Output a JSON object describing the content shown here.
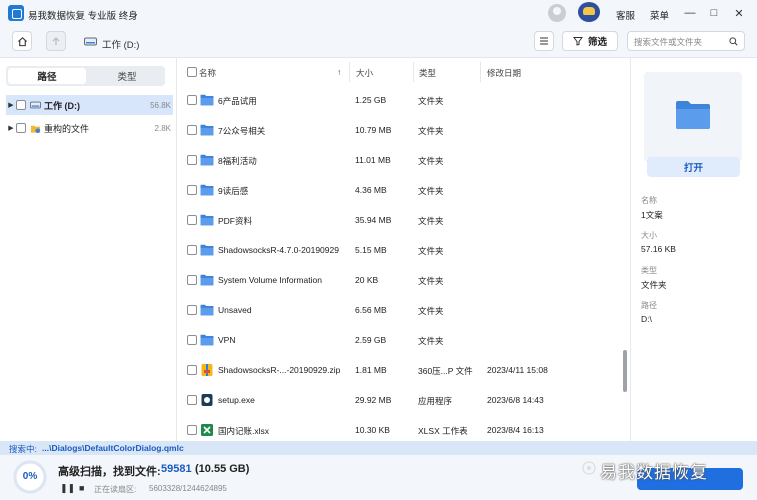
{
  "app": {
    "title": "易我数据恢复 专业版 终身",
    "service_label": "客服",
    "menu_label": "菜单"
  },
  "window": {
    "minimize_glyph": "—",
    "maximize_glyph": "□",
    "close_glyph": "✕"
  },
  "toolbar": {
    "breadcrumb": "工作 (D:)",
    "filter_label": "筛选",
    "search_placeholder": "搜索文件或文件夹"
  },
  "sidebar": {
    "tabs": [
      {
        "label": "路径",
        "active": true
      },
      {
        "label": "类型",
        "active": false
      }
    ],
    "items": [
      {
        "label": "工作 (D:)",
        "size": "56.8K",
        "icon": "drive-icon",
        "selected": true
      },
      {
        "label": "重构的文件",
        "size": "2.8K",
        "icon": "rebuilt-files-icon",
        "selected": false
      }
    ]
  },
  "file_list": {
    "headers": {
      "name": "名称",
      "size": "大小",
      "type": "类型",
      "date": "修改日期"
    },
    "rows": [
      {
        "name": "6产品试用",
        "size": "1.25 GB",
        "type": "文件夹",
        "date": "",
        "icon": "folder-icon"
      },
      {
        "name": "7公众号相关",
        "size": "10.79 MB",
        "type": "文件夹",
        "date": "",
        "icon": "folder-icon"
      },
      {
        "name": "8福利活动",
        "size": "11.01 MB",
        "type": "文件夹",
        "date": "",
        "icon": "folder-icon"
      },
      {
        "name": "9读后感",
        "size": "4.36 MB",
        "type": "文件夹",
        "date": "",
        "icon": "folder-icon"
      },
      {
        "name": "PDF资料",
        "size": "35.94 MB",
        "type": "文件夹",
        "date": "",
        "icon": "folder-icon"
      },
      {
        "name": "ShadowsocksR-4.7.0-20190929",
        "size": "5.15 MB",
        "type": "文件夹",
        "date": "",
        "icon": "folder-icon"
      },
      {
        "name": "System Volume Information",
        "size": "20 KB",
        "type": "文件夹",
        "date": "",
        "icon": "folder-icon"
      },
      {
        "name": "Unsaved",
        "size": "6.56 MB",
        "type": "文件夹",
        "date": "",
        "icon": "folder-icon"
      },
      {
        "name": "VPN",
        "size": "2.59 GB",
        "type": "文件夹",
        "date": "",
        "icon": "folder-icon"
      },
      {
        "name": "ShadowsocksR-...-20190929.zip",
        "size": "1.81 MB",
        "type": "360压...P 文件",
        "date": "2023/4/11 15:08",
        "icon": "zip-icon"
      },
      {
        "name": "setup.exe",
        "size": "29.92 MB",
        "type": "应用程序",
        "date": "2023/6/8 14:43",
        "icon": "exe-icon"
      },
      {
        "name": "国内记账.xlsx",
        "size": "10.30 KB",
        "type": "XLSX 工作表",
        "date": "2023/8/4 16:13",
        "icon": "excel-icon"
      }
    ]
  },
  "details": {
    "open_label": "打开",
    "props": [
      {
        "label": "名称",
        "value": "1文案"
      },
      {
        "label": "大小",
        "value": "57.16 KB"
      },
      {
        "label": "类型",
        "value": "文件夹"
      },
      {
        "label": "路径",
        "value": "D:\\"
      }
    ]
  },
  "status": {
    "searching_label": "搜索中:",
    "searching_path": "...\\Dialogs\\DefaultColorDialog.qmlc"
  },
  "scan": {
    "progress_text": "0%",
    "progress_fraction": 0.0,
    "title": "高级扫描，找到文件:",
    "count": "59581",
    "size": "(10.55 GB)",
    "reading_label": "正在读扇区:",
    "reading_value": "5603328/1244624895",
    "pause_glyph": "❚❚",
    "stop_glyph": "■"
  },
  "watermark": {
    "text": "易我数据恢复"
  },
  "colors": {
    "accent": "#1f6fe0",
    "folder": "#4f93e8",
    "selected_row": "#d7e6fb",
    "status_strip": "#d9e6f8"
  }
}
